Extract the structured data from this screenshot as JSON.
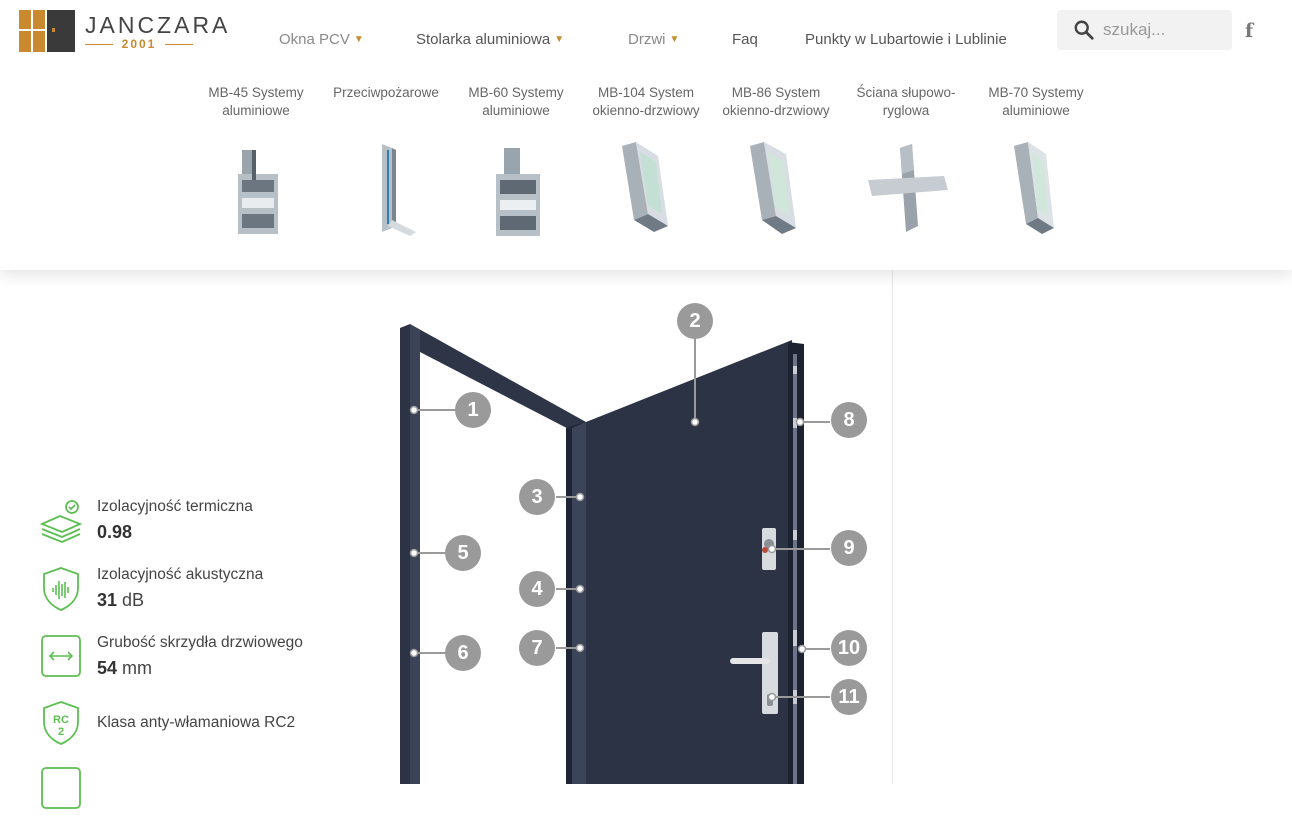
{
  "brand": {
    "name": "JANCZARA",
    "year": "2001"
  },
  "nav": {
    "items": [
      {
        "label": "Okna PCV",
        "dropdown": true,
        "style": "muted"
      },
      {
        "label": "Stolarka aluminiowa",
        "dropdown": true,
        "style": "dark"
      },
      {
        "label": "Drzwi",
        "dropdown": true,
        "style": "muted"
      },
      {
        "label": "Faq",
        "dropdown": false,
        "style": "dark"
      },
      {
        "label": "Punkty w Lubartowie i Lublinie",
        "dropdown": false,
        "style": "dark"
      }
    ]
  },
  "search": {
    "placeholder": "szukaj..."
  },
  "social": {
    "facebook": "f"
  },
  "submenu": [
    {
      "label": "MB-45 Systemy aluminiowe",
      "icon": "aluminium-profile-icon"
    },
    {
      "label": "Przeciwpożarowe",
      "icon": "fire-profile-icon"
    },
    {
      "label": "MB-60 Systemy aluminiowe",
      "icon": "aluminium-profile-icon"
    },
    {
      "label": "MB-104 System okienno-drzwiowy",
      "icon": "window-profile-icon"
    },
    {
      "label": "MB-86 System okienno-drzwiowy",
      "icon": "window-profile-icon"
    },
    {
      "label": "Ściana słupowo-ryglowa",
      "icon": "mullion-transom-icon"
    },
    {
      "label": "MB-70 Systemy aluminiowe",
      "icon": "window-profile-icon"
    }
  ],
  "features": [
    {
      "title": "Izolacyjność termiczna",
      "value": "0.98",
      "unit": "",
      "icon": "thermal-insulation-icon"
    },
    {
      "title": "Izolacyjność akustyczna",
      "value": "31",
      "unit": "dB",
      "icon": "acoustic-shield-icon"
    },
    {
      "title": "Grubość skrzydła drzwiowego",
      "value": "54",
      "unit": "mm",
      "icon": "thickness-icon"
    },
    {
      "title": "Klasa anty-włamaniowa RC2",
      "value": "",
      "unit": "",
      "icon": "rc2-shield-icon"
    }
  ],
  "markers": [
    "1",
    "2",
    "3",
    "4",
    "5",
    "6",
    "7",
    "8",
    "9",
    "10",
    "11"
  ],
  "colors": {
    "accent": "#c9892f",
    "door": "#2b3344",
    "marker": "#9a9a9a",
    "featureGreen": "#5cbf52"
  }
}
